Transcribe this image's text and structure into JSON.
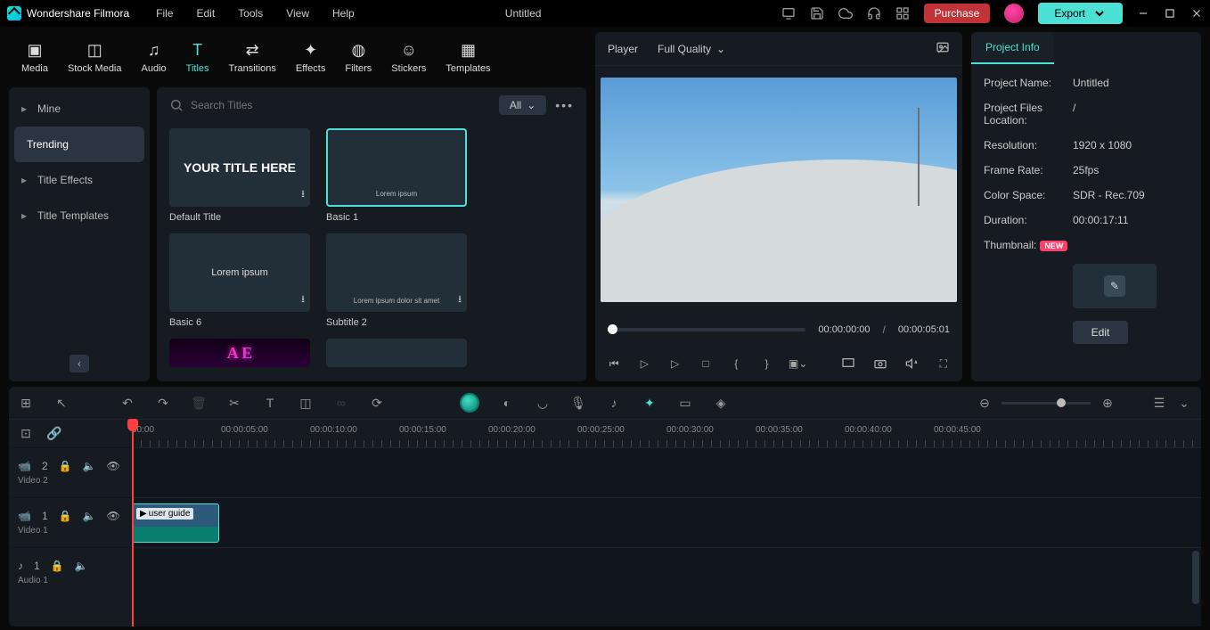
{
  "app_name": "Wondershare Filmora",
  "menubar": [
    "File",
    "Edit",
    "Tools",
    "View",
    "Help"
  ],
  "doc_title": "Untitled",
  "purchase_label": "Purchase",
  "export_label": "Export",
  "top_tabs": [
    {
      "label": "Media"
    },
    {
      "label": "Stock Media"
    },
    {
      "label": "Audio"
    },
    {
      "label": "Titles"
    },
    {
      "label": "Transitions"
    },
    {
      "label": "Effects"
    },
    {
      "label": "Filters"
    },
    {
      "label": "Stickers"
    },
    {
      "label": "Templates"
    }
  ],
  "categories": [
    {
      "label": "Mine"
    },
    {
      "label": "Trending"
    },
    {
      "label": "Title Effects"
    },
    {
      "label": "Title Templates"
    }
  ],
  "search_placeholder": "Search Titles",
  "filter_all": "All",
  "titles_items": [
    {
      "label": "Default Title",
      "text": "YOUR TITLE HERE",
      "selected": false,
      "downloadable": true
    },
    {
      "label": "Basic 1",
      "text": "Lorem ipsum",
      "selected": true,
      "downloadable": false,
      "small": true
    },
    {
      "label": "Basic 6",
      "text": "Lorem ipsum",
      "selected": false,
      "downloadable": true
    },
    {
      "label": "Subtitle 2",
      "text": "Lorem ipsum dolor sit amet",
      "selected": false,
      "downloadable": true,
      "small": true
    }
  ],
  "player": {
    "title": "Player",
    "quality": "Full Quality",
    "current_time": "00:00:00:00",
    "total_time": "00:00:05:01"
  },
  "project_info": {
    "tab_label": "Project Info",
    "rows": [
      {
        "key": "Project Name:",
        "val": "Untitled"
      },
      {
        "key": "Project Files Location:",
        "val": "/"
      },
      {
        "key": "Resolution:",
        "val": "1920 x 1080"
      },
      {
        "key": "Frame Rate:",
        "val": "25fps"
      },
      {
        "key": "Color Space:",
        "val": "SDR - Rec.709"
      },
      {
        "key": "Duration:",
        "val": "00:00:17:11"
      }
    ],
    "thumbnail_label": "Thumbnail:",
    "new_badge": "NEW",
    "edit_label": "Edit"
  },
  "timeline": {
    "ruler_marks": [
      "00:00",
      "00:00:05:00",
      "00:00:10:00",
      "00:00:15:00",
      "00:00:20:00",
      "00:00:25:00",
      "00:00:30:00",
      "00:00:35:00",
      "00:00:40:00",
      "00:00:45:00"
    ],
    "tracks": [
      {
        "name": "Video 2",
        "icon": "video",
        "num": "2"
      },
      {
        "name": "Video 1",
        "icon": "video",
        "num": "1"
      },
      {
        "name": "Audio 1",
        "icon": "audio",
        "num": "1"
      }
    ],
    "clip_label": "user guide"
  }
}
